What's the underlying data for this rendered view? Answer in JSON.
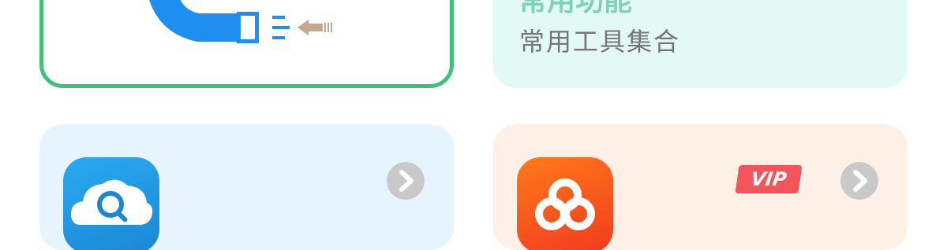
{
  "cards": {
    "magnet": {
      "icon": "magnet-icon",
      "accent": "#3cc377"
    },
    "tools": {
      "title_partial": "常用功能",
      "subtitle": "常用工具集合",
      "background": "#e3f9f4"
    },
    "search": {
      "icon": "cloud-search-icon",
      "chevron_icon": "chevron-right-icon",
      "background": "#e6f5fd"
    },
    "baidu": {
      "icon": "baidu-netdisk-icon",
      "badge": "VIP",
      "chevron_icon": "chevron-right-icon",
      "background": "#fdf1e7"
    }
  }
}
